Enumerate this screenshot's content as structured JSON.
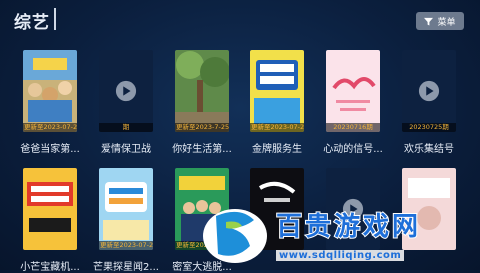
{
  "header": {
    "title": "综艺",
    "menu_label": "菜单"
  },
  "row1": [
    {
      "title": "爸爸当家第...",
      "badge": "更新至2023-07-2",
      "art": "a1"
    },
    {
      "title": "爱情保卫战",
      "badge": "期",
      "art": "none"
    },
    {
      "title": "你好生活第...",
      "badge": "更新至2023-7-25",
      "art": "a3"
    },
    {
      "title": "金牌服务生",
      "badge": "更新至2023-07-2",
      "art": "a4"
    },
    {
      "title": "心动的信号...",
      "badge": "20230716期",
      "art": "a5"
    },
    {
      "title": "欢乐集结号",
      "badge": "20230725期",
      "art": "none"
    }
  ],
  "row2": [
    {
      "title": "小芒宝藏机...",
      "art": "b1"
    },
    {
      "title": "芒果探星闻2...",
      "badge": "更新至2023-07-2",
      "art": "b2"
    },
    {
      "title": "密室大逃脱...",
      "badge": "更新至2023-07-2",
      "art": "b3"
    },
    {
      "title": "",
      "art": "b4"
    },
    {
      "title": "",
      "art": "none"
    },
    {
      "title": "",
      "art": "b6"
    }
  ],
  "watermark": {
    "cn": "百贵游戏网",
    "url": "www.sdqlliqing.com"
  },
  "colors": {
    "badge": "#f2b339",
    "background": "#0b1f3e",
    "watermark": "#1e6fd9"
  }
}
